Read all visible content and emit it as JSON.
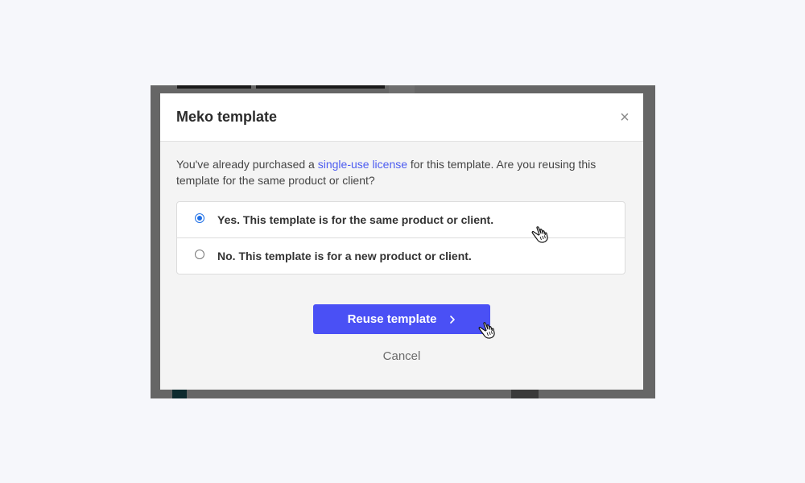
{
  "modal": {
    "title": "Meko template",
    "close_label": "×",
    "description_before": "You've already purchased a ",
    "description_link": "single-use license",
    "description_after": " for this template. Are you reusing this template for the same product or client?",
    "options": [
      {
        "label": "Yes. This template is for the same product or client.",
        "selected": true
      },
      {
        "label": "No. This template is for a new product or client.",
        "selected": false
      }
    ],
    "primary_button": "Reuse template",
    "cancel_label": "Cancel"
  },
  "colors": {
    "accent": "#4a50f5",
    "link": "#4c5cf0",
    "radio_selected": "#1e6fe6",
    "overlay": "#666666",
    "page_bg": "#f6f7fb"
  },
  "icons": {
    "close": "close-icon",
    "chevron": "chevron-right-icon",
    "cursor": "hand-pointer-icon"
  }
}
